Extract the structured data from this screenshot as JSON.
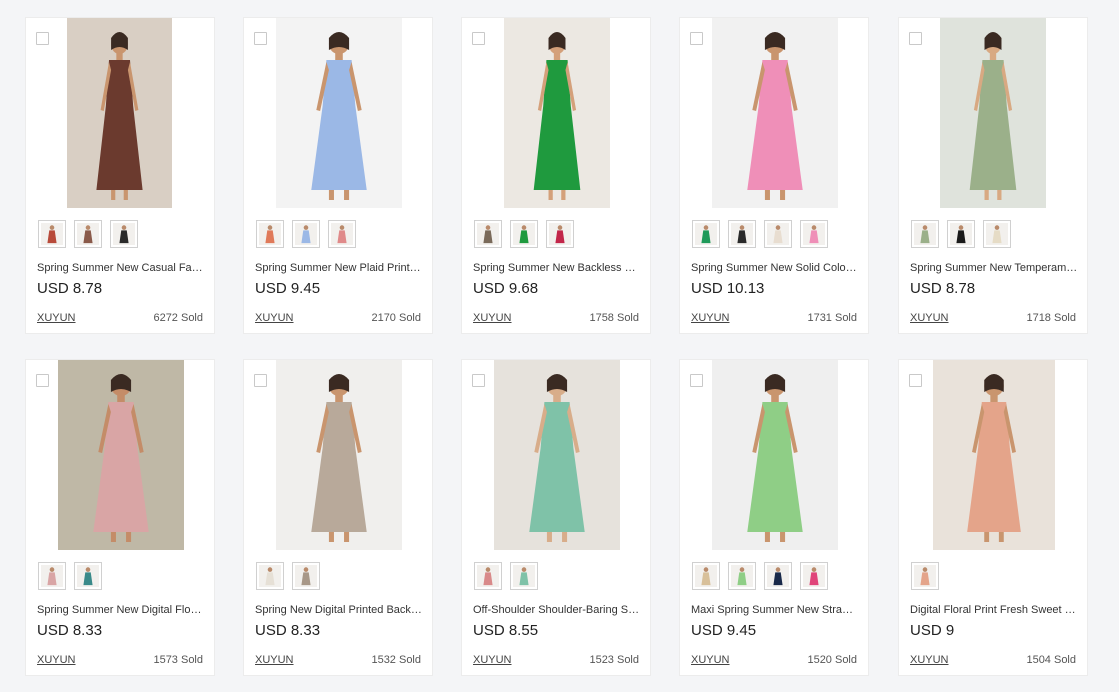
{
  "products": [
    {
      "title": "Spring Summer New Casual Fashion Square Neck Dress",
      "price": "USD 8.78",
      "vendor": "XUYUN",
      "sold": "6272 Sold",
      "bg": "#d9cfc4",
      "dress": "#6b3a2e",
      "skin": "#c9956e",
      "thumbs": [
        "#b84a3a",
        "#8a5a4a",
        "#2a2a2a"
      ]
    },
    {
      "title": "Spring Summer New Plaid Print V-Neck Dress",
      "price": "USD 9.45",
      "vendor": "XUYUN",
      "sold": "2170 Sold",
      "bg": "#f3f3f3",
      "dress": "#9bb8e6",
      "skin": "#c9956e",
      "thumbs": [
        "#e07a5a",
        "#9bb8e6",
        "#e08a8a"
      ]
    },
    {
      "title": "Spring Summer New Backless Elegant Dress",
      "price": "USD 9.68",
      "vendor": "XUYUN",
      "sold": "1758 Sold",
      "bg": "#ece8e2",
      "dress": "#1f9a3e",
      "skin": "#d4a07a",
      "thumbs": [
        "#7a6a5a",
        "#1f9a3e",
        "#c2264a"
      ]
    },
    {
      "title": "Spring Summer New Solid Color Two Piece Set",
      "price": "USD 10.13",
      "vendor": "XUYUN",
      "sold": "1731 Sold",
      "bg": "#f1f1f1",
      "dress": "#ef8fb8",
      "skin": "#c9956e",
      "thumbs": [
        "#1f9a5a",
        "#2a2a2a",
        "#e8ddd0",
        "#ef8fb8"
      ]
    },
    {
      "title": "Spring Summer New Temperament Cutout Maxi Dress",
      "price": "USD 8.78",
      "vendor": "XUYUN",
      "sold": "1718 Sold",
      "bg": "#dfe3dc",
      "dress": "#9bb08a",
      "skin": "#d8a982",
      "thumbs": [
        "#9bb08a",
        "#1a1a1a",
        "#e6dcc6"
      ]
    },
    {
      "title": "Spring Summer New Digital Floral Print Dress",
      "price": "USD 8.33",
      "vendor": "XUYUN",
      "sold": "1573 Sold",
      "bg": "#bfb8a6",
      "dress": "#d9a5a5",
      "skin": "#c48c68",
      "thumbs": [
        "#d9a5a5",
        "#3a8a8a"
      ]
    },
    {
      "title": "Spring New Digital Printed Backless Dress",
      "price": "USD 8.33",
      "vendor": "XUYUN",
      "sold": "1532 Sold",
      "bg": "#f0efed",
      "dress": "#b8a99a",
      "skin": "#c9956e",
      "thumbs": [
        "#e6e0d6",
        "#a89888"
      ]
    },
    {
      "title": "Off-Shoulder Shoulder-Baring Sleeve Dress",
      "price": "USD 8.55",
      "vendor": "XUYUN",
      "sold": "1523 Sold",
      "bg": "#e6e2dc",
      "dress": "#7fc2a8",
      "skin": "#d8ad8a",
      "thumbs": [
        "#d98a8a",
        "#7fc2a8"
      ]
    },
    {
      "title": "Maxi Spring Summer New Strapless Dress",
      "price": "USD 9.45",
      "vendor": "XUYUN",
      "sold": "1520 Sold",
      "bg": "#efefef",
      "dress": "#8fce86",
      "skin": "#c9956e",
      "thumbs": [
        "#d8c09a",
        "#8fce86",
        "#1a2a4a",
        "#e0457a"
      ]
    },
    {
      "title": "Digital Floral Print Fresh Sweet Maxi Dress",
      "price": "USD 9",
      "vendor": "XUYUN",
      "sold": "1504 Sold",
      "bg": "#e9e2da",
      "dress": "#e4a48a",
      "skin": "#c9956e",
      "thumbs": [
        "#e4a48a"
      ]
    }
  ]
}
